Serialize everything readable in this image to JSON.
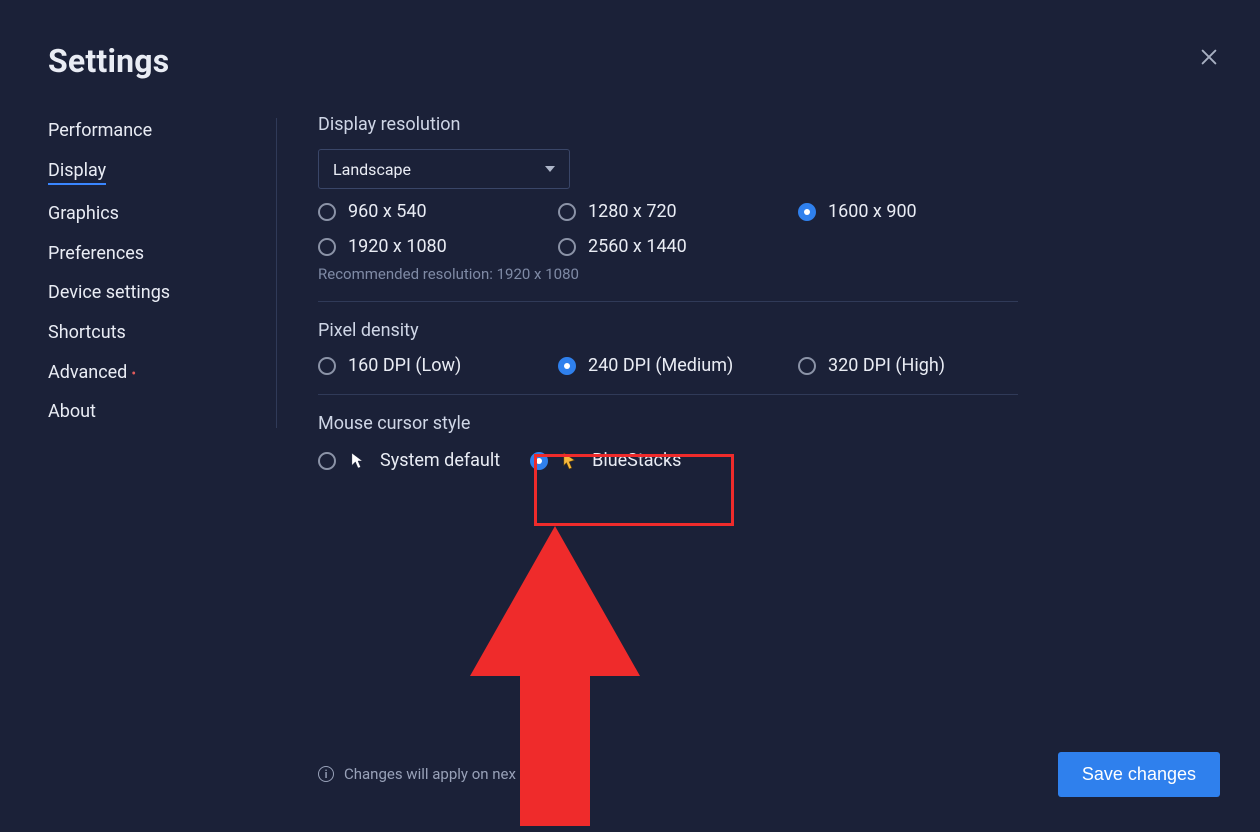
{
  "title": "Settings",
  "close_label": "Close",
  "sidebar": {
    "items": [
      {
        "label": "Performance",
        "active": false
      },
      {
        "label": "Display",
        "active": true
      },
      {
        "label": "Graphics",
        "active": false
      },
      {
        "label": "Preferences",
        "active": false
      },
      {
        "label": "Device settings",
        "active": false
      },
      {
        "label": "Shortcuts",
        "active": false
      },
      {
        "label": "Advanced",
        "active": false,
        "dot": true
      },
      {
        "label": "About",
        "active": false
      }
    ]
  },
  "display": {
    "section_titles": {
      "resolution": "Display resolution",
      "pixel_density": "Pixel density",
      "cursor": "Mouse cursor style"
    },
    "orientation": {
      "value": "Landscape"
    },
    "resolutions": [
      {
        "label": "960 x 540",
        "selected": false
      },
      {
        "label": "1280 x 720",
        "selected": false
      },
      {
        "label": "1600 x 900",
        "selected": true
      },
      {
        "label": "1920 x 1080",
        "selected": false
      },
      {
        "label": "2560 x 1440",
        "selected": false
      }
    ],
    "recommended": "Recommended resolution: 1920 x 1080",
    "dpi": [
      {
        "label": "160 DPI (Low)",
        "selected": false
      },
      {
        "label": "240 DPI (Medium)",
        "selected": true
      },
      {
        "label": "320 DPI (High)",
        "selected": false
      }
    ],
    "cursor": [
      {
        "label": "System default",
        "selected": false,
        "icon": "white-cursor"
      },
      {
        "label": "BlueStacks",
        "selected": true,
        "icon": "gold-cursor"
      }
    ]
  },
  "annotations": {
    "highlight_target": "cursor-bluestacks"
  },
  "footer": {
    "info": "Changes will apply on nex",
    "save_label": "Save changes"
  },
  "colors": {
    "accent": "#2f80ed",
    "background": "#1b2138",
    "highlight": "#ef2b2b",
    "gold": "#f6b73c"
  }
}
